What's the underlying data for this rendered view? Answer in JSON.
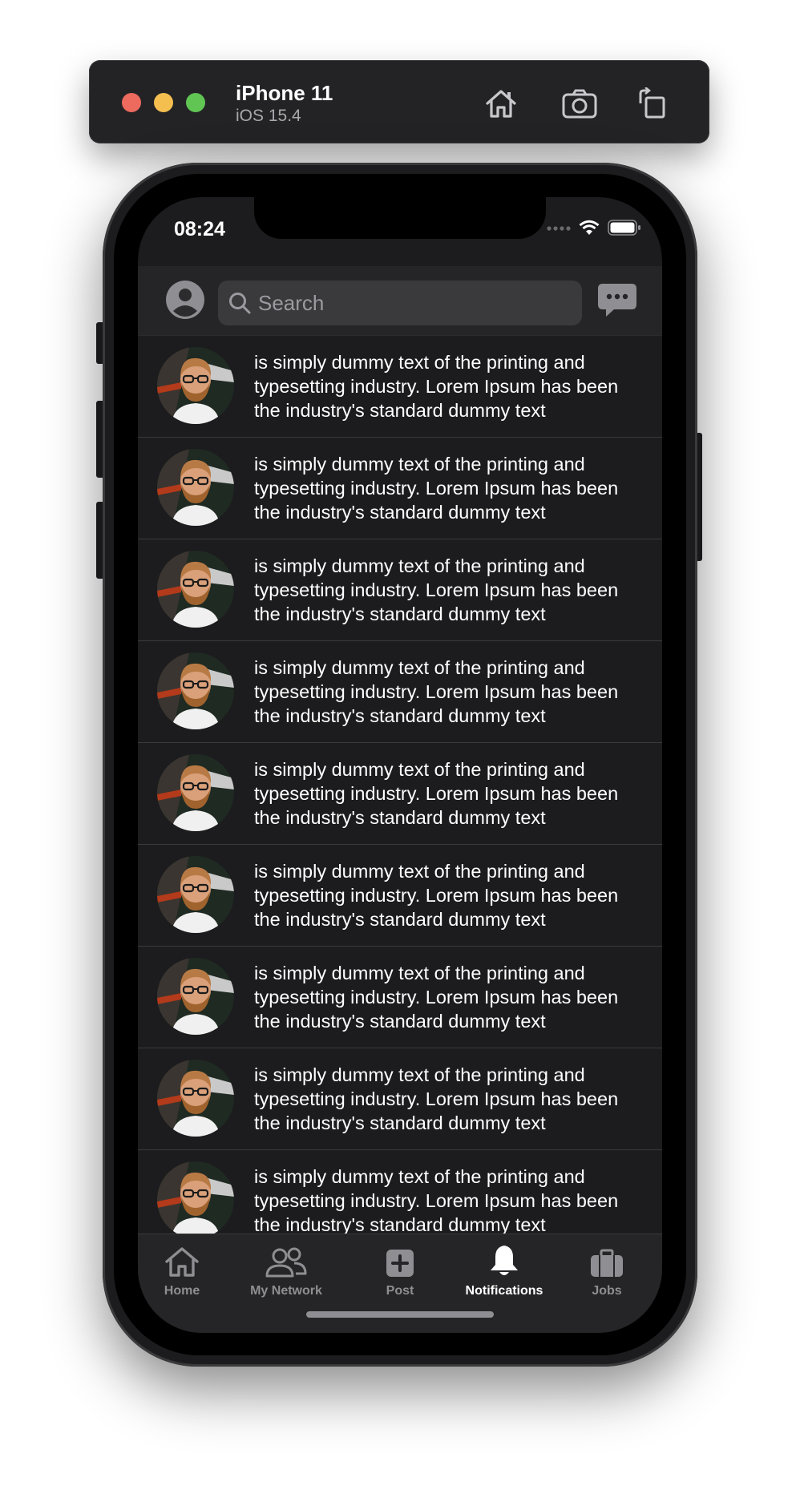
{
  "toolbar": {
    "device_name": "iPhone 11",
    "os_version": "iOS 15.4",
    "buttons": [
      "home-icon",
      "screenshot-icon",
      "rotate-icon"
    ]
  },
  "status_bar": {
    "time": "08:24",
    "icons": [
      "signal-icon",
      "wifi-icon",
      "battery-icon"
    ]
  },
  "navbar": {
    "search_placeholder": "Search",
    "icons": [
      "profile-avatar-icon",
      "search-icon",
      "messages-icon"
    ]
  },
  "notifications": [
    {
      "text": "is simply dummy text of the printing and typesetting industry. Lorem Ipsum has been the industry's standard dummy text"
    },
    {
      "text": "is simply dummy text of the printing and typesetting industry. Lorem Ipsum has been the industry's standard dummy text"
    },
    {
      "text": "is simply dummy text of the printing and typesetting industry. Lorem Ipsum has been the industry's standard dummy text"
    },
    {
      "text": "is simply dummy text of the printing and typesetting industry. Lorem Ipsum has been the industry's standard dummy text"
    },
    {
      "text": "is simply dummy text of the printing and typesetting industry. Lorem Ipsum has been the industry's standard dummy text"
    },
    {
      "text": "is simply dummy text of the printing and typesetting industry. Lorem Ipsum has been the industry's standard dummy text"
    },
    {
      "text": "is simply dummy text of the printing and typesetting industry. Lorem Ipsum has been the industry's standard dummy text"
    },
    {
      "text": "is simply dummy text of the printing and typesetting industry. Lorem Ipsum has been the industry's standard dummy text"
    },
    {
      "text": "is simply dummy text of the printing and typesetting industry. Lorem Ipsum has been the industry's standard dummy text"
    }
  ],
  "tabbar": {
    "tabs": [
      {
        "label": "Home",
        "icon": "home-icon",
        "active": false
      },
      {
        "label": "My Network",
        "icon": "network-icon",
        "active": false
      },
      {
        "label": "Post",
        "icon": "post-icon",
        "active": false
      },
      {
        "label": "Notifications",
        "icon": "bell-icon",
        "active": true
      },
      {
        "label": "Jobs",
        "icon": "briefcase-icon",
        "active": false
      }
    ]
  },
  "colors": {
    "background": "#1c1c1e",
    "bar": "#252527",
    "active_tab": "#ffffff",
    "inactive_tab": "#8e8e93"
  }
}
